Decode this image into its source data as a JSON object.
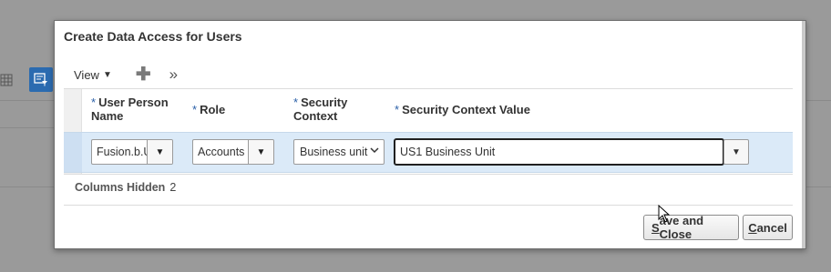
{
  "background": {
    "grid_icon": "grid-icon",
    "filter_icon": "query-filter-icon"
  },
  "dialog": {
    "title": "Create Data Access for Users",
    "toolbar": {
      "view_label": "View",
      "view_caret": "▼",
      "add_icon": "plus-icon",
      "add_glyph": "✚",
      "more_icon": "double-chevron-right-icon",
      "more_glyph": "»"
    },
    "table": {
      "headers": [
        {
          "required": "*",
          "line1": "User Person",
          "line2": "Name"
        },
        {
          "required": "*",
          "line1": "Role",
          "line2": ""
        },
        {
          "required": "*",
          "line1": "Security",
          "line2": "Context"
        },
        {
          "required": "*",
          "line1": "Security Context Value",
          "line2": ""
        }
      ],
      "row": {
        "user_person_name": "Fusion.b.U",
        "role": "Accounts P",
        "security_context": "Business unit",
        "security_context_value": "US1 Business Unit"
      },
      "dropdown_glyph": "▼",
      "select_glyph": "⌄"
    },
    "columns_hidden": {
      "label": "Columns Hidden",
      "count": "2"
    },
    "buttons": {
      "save_prefix": "S",
      "save_rest": "ave and Close",
      "cancel_prefix": "C",
      "cancel_rest": "ancel"
    }
  },
  "colors": {
    "row_highlight": "#dbeaf8",
    "required_star": "#2a5fa8",
    "overlay": "#9a9a9a"
  }
}
